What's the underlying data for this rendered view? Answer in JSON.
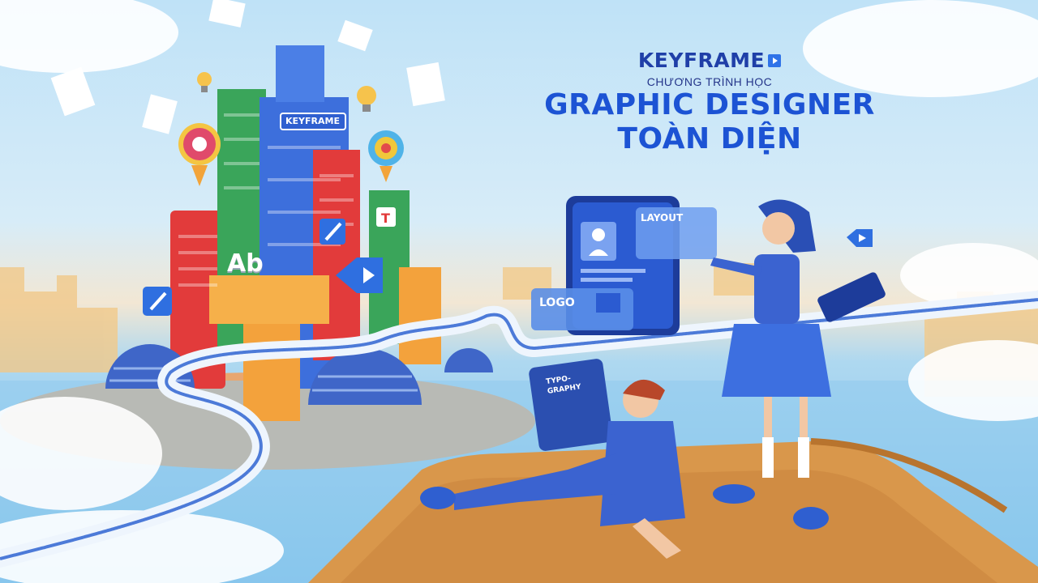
{
  "header": {
    "brand": "KEYFRAME",
    "program_label": "CHƯƠNG TRÌNH HỌC",
    "title_line1": "GRAPHIC DESIGNER",
    "title_line2": "TOÀN DIỆN"
  },
  "city": {
    "tower_sign": "KEYFRAME",
    "ab_sign": "Ab"
  },
  "cards": {
    "layout": "LAYOUT",
    "logo": "LOGO",
    "typography_line1": "TYPO-",
    "typography_line2": "GRAPHY"
  },
  "icons": [
    "play-icon",
    "color-wheel-icon",
    "lightbulb-icon",
    "brush-icon",
    "eyedropper-icon",
    "text-icon",
    "user-icon",
    "image-icon"
  ],
  "colors": {
    "brand_blue": "#1c53d4",
    "sky": "#bfe2f7",
    "sea": "#7fc2ea",
    "boat_deck": "#d9974b",
    "tower_red": "#e23b3b",
    "tower_green": "#3aa55a",
    "tower_orange": "#f3a23c"
  }
}
